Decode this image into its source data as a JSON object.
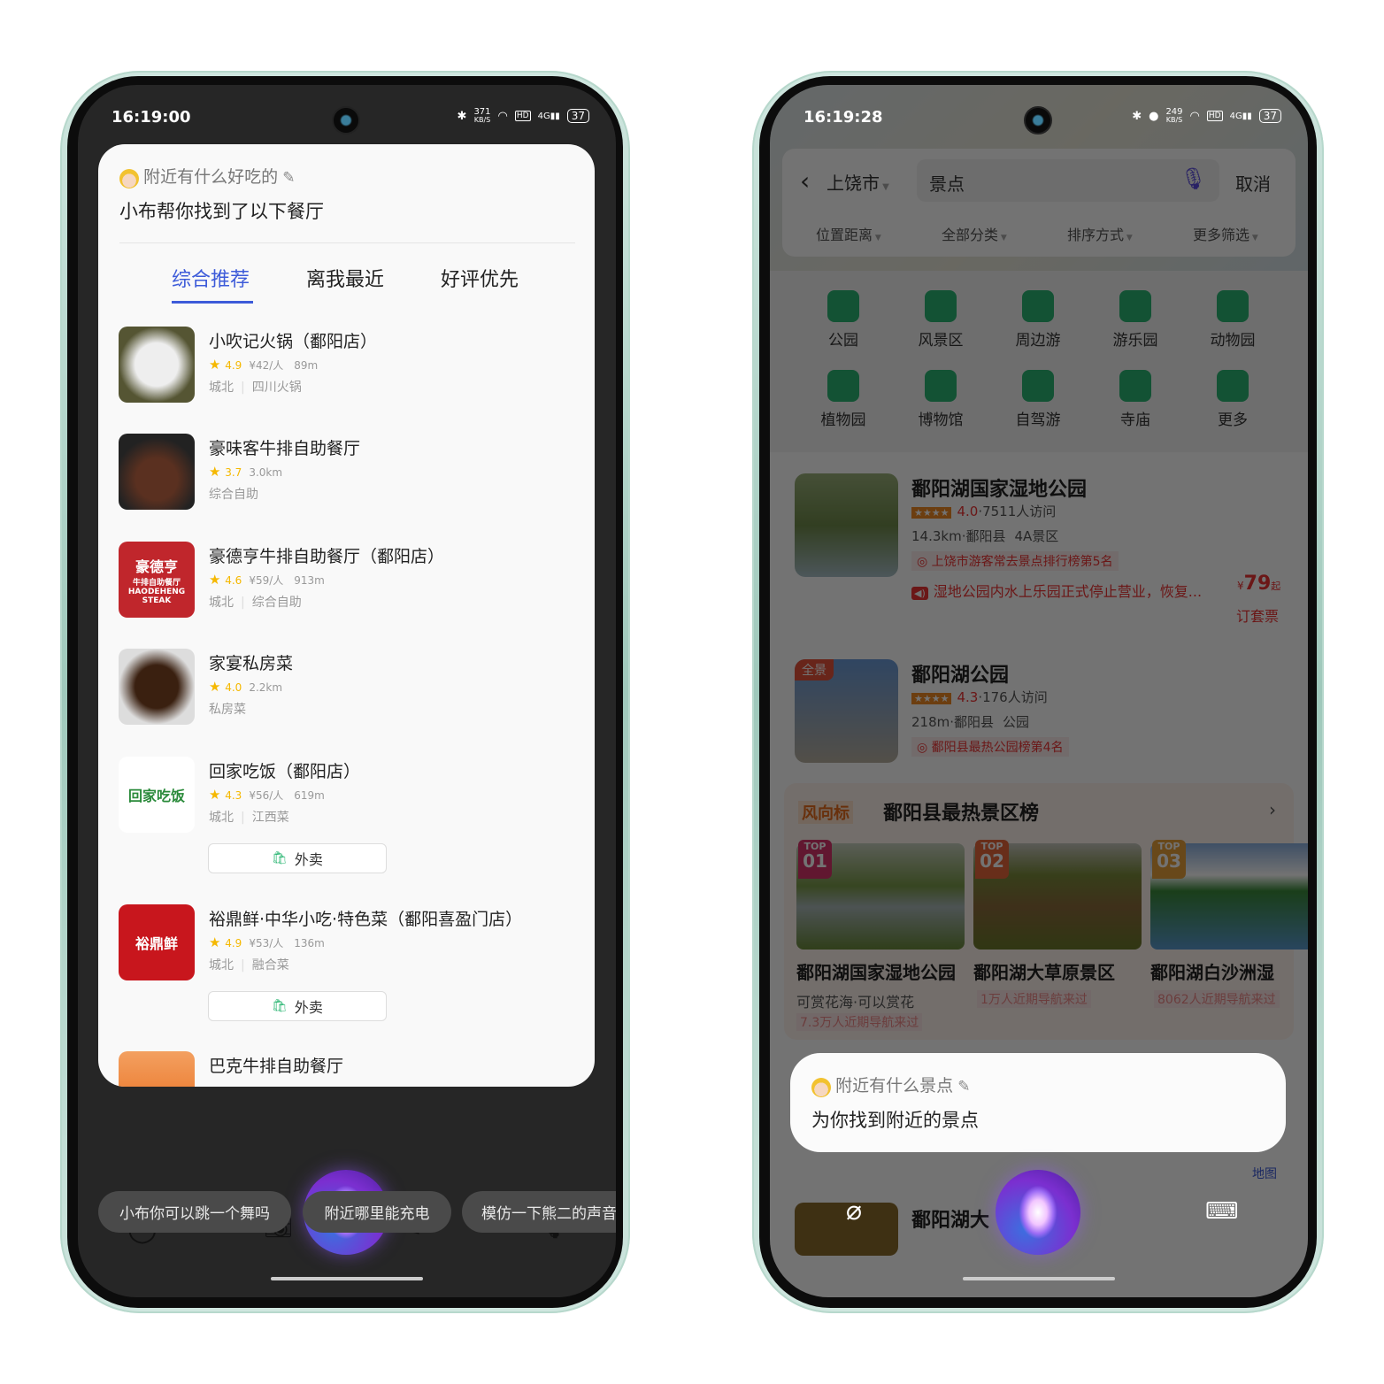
{
  "left_phone": {
    "status": {
      "time": "16:19:00",
      "net_speed": "371",
      "net_unit": "KB/S",
      "network": "4G",
      "hd": "HD",
      "battery": "37"
    },
    "assistant": {
      "query": "附近有什么好吃的",
      "reply": "小布帮你找到了以下餐厅"
    },
    "tabs": [
      {
        "label": "综合推荐",
        "active": true
      },
      {
        "label": "离我最近"
      },
      {
        "label": "好评优先"
      }
    ],
    "restaurants": [
      {
        "name": "小吹记火锅（鄱阳店）",
        "rating": "4.9",
        "price": "¥42/人",
        "distance": "89m",
        "area": "城北",
        "category": "四川火锅"
      },
      {
        "name": "豪味客牛排自助餐厅",
        "rating": "3.7",
        "price": "",
        "distance": "3.0km",
        "area": "",
        "category": "综合自助"
      },
      {
        "name": "豪德亨牛排自助餐厅（鄱阳店）",
        "rating": "4.6",
        "price": "¥59/人",
        "distance": "913m",
        "area": "城北",
        "category": "综合自助",
        "logo": [
          "豪德亨",
          "牛排自助餐厅",
          "HAODEHENG STEAK"
        ]
      },
      {
        "name": "家宴私房菜",
        "rating": "4.0",
        "price": "",
        "distance": "2.2km",
        "area": "",
        "category": "私房菜"
      },
      {
        "name": "回家吃饭（鄱阳店）",
        "rating": "4.3",
        "price": "¥56/人",
        "distance": "619m",
        "area": "城北",
        "category": "江西菜",
        "logo": [
          "回家吃饭"
        ],
        "takeout": "外卖"
      },
      {
        "name": "裕鼎鲜·中华小吃·特色菜（鄱阳喜盈门店）",
        "rating": "4.9",
        "price": "¥53/人",
        "distance": "136m",
        "area": "城北",
        "category": "融合菜",
        "logo": [
          "裕鼎鲜"
        ],
        "takeout": "外卖"
      },
      {
        "name": "巴克牛排自助餐厅"
      }
    ],
    "suggestions": [
      "小布你可以跳一个舞吗",
      "附近哪里能充电",
      "模仿一下熊二的声音"
    ],
    "accent": "#3d5bd9"
  },
  "right_phone": {
    "status": {
      "time": "16:19:28",
      "net_speed": "249",
      "net_unit": "KB/S",
      "network": "4G",
      "hd": "HD",
      "battery": "37"
    },
    "search": {
      "city": "上饶市",
      "query": "景点",
      "cancel": "取消"
    },
    "filters": [
      "位置距离",
      "全部分类",
      "排序方式",
      "更多筛选"
    ],
    "categories": [
      "公园",
      "风景区",
      "周边游",
      "游乐园",
      "动物园",
      "植物园",
      "博物馆",
      "自驾游",
      "寺庙",
      "更多"
    ],
    "results": [
      {
        "name": "鄱阳湖国家湿地公园",
        "rating": "4.0",
        "visits": "7511人访问",
        "distance": "14.3km",
        "county": "鄱阳县",
        "type": "4A景区",
        "rank": "上饶市游客常去景点排行榜第5名",
        "notice": "湿地公园内水上乐园正式停止营业，恢复...",
        "price": "79",
        "price_prefix": "¥",
        "price_suffix": "起",
        "action": "订套票"
      },
      {
        "name": "鄱阳湖公园",
        "badge": "全景",
        "rating": "4.3",
        "visits": "176人访问",
        "distance": "218m",
        "county": "鄱阳县",
        "type": "公园",
        "rank": "鄱阳县最热公园榜第4名"
      }
    ],
    "ranking": {
      "brand": "风向标",
      "title": "鄱阳县最热景区榜",
      "items": [
        {
          "rank": "01",
          "name": "鄱阳湖国家湿地公园",
          "desc": "可赏花海·可以赏花",
          "nav": "7.3万人近期导航来过"
        },
        {
          "rank": "02",
          "name": "鄱阳湖大草原景区",
          "nav": "1万人近期导航来过"
        },
        {
          "rank": "03",
          "name": "鄱阳湖白沙洲湿",
          "nav": "8062人近期导航来过"
        }
      ],
      "top_label": "TOP"
    },
    "behind": {
      "name": "鄱阳湖大",
      "map": "地图"
    },
    "assistant": {
      "query": "附近有什么景点",
      "reply": "为你找到附近的景点"
    }
  }
}
